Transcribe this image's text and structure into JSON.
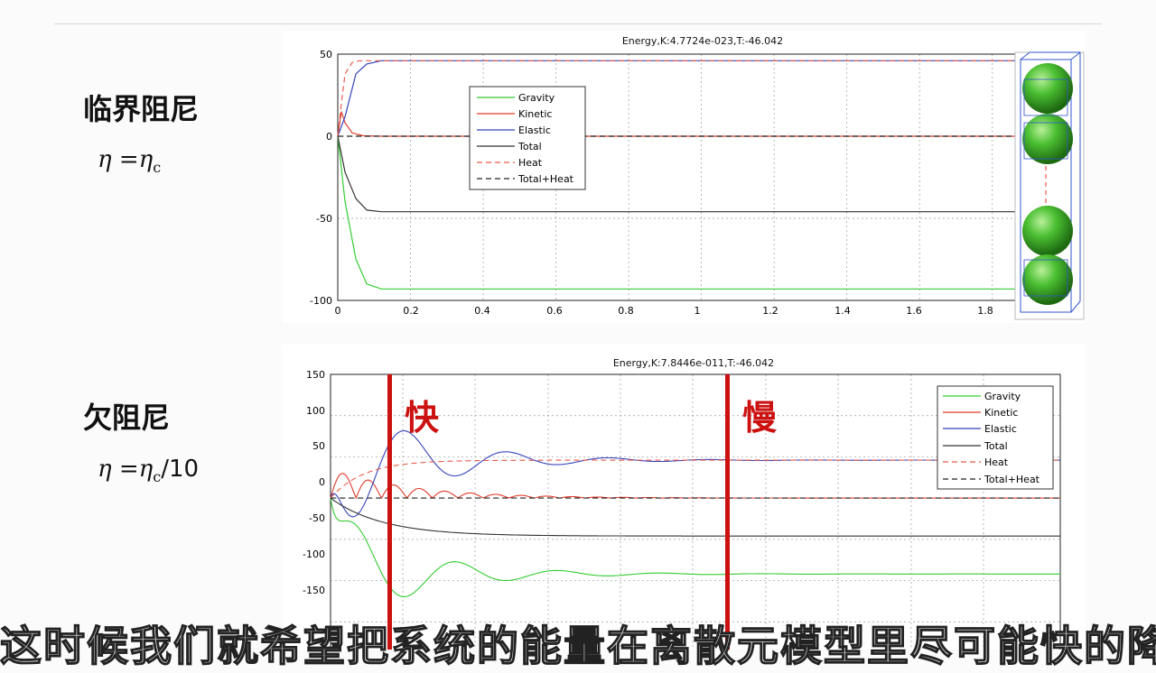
{
  "slide": {
    "critical_label": "临界阻尼",
    "critical_formula_lhs": "η =",
    "critical_formula_rhs": "η",
    "critical_formula_sub": "c",
    "under_label": "欠阻尼",
    "under_formula_lhs": "η =",
    "under_formula_rhs": "η",
    "under_formula_sub": "c",
    "under_formula_tail": "/10",
    "subtitle": "这时候我们就希望把系统的能量在离散元模型里尽可能快的降低"
  },
  "colors": {
    "gravity": "#33cc33",
    "kinetic": "#e03b2a",
    "elastic": "#3344bb",
    "total": "#333333",
    "heat": "#e85a4a",
    "total_heat": "#222222",
    "marker": "#cc1111",
    "sphere": "#3fae2a"
  },
  "chart_data": [
    {
      "type": "line",
      "title": "Energy,K:4.7724e-023,T:-46.042",
      "xlim": [
        0,
        1.9
      ],
      "ylim": [
        -100,
        50
      ],
      "xticks": [
        "0",
        "0.2",
        "0.4",
        "0.6",
        "0.8",
        "1",
        "1.2",
        "1.4",
        "1.6",
        "1.8"
      ],
      "yticks": [
        "50",
        "0",
        "-50",
        "-100"
      ],
      "grid": true,
      "legend_position": "upper-left",
      "legend": [
        "Gravity",
        "Kinetic",
        "Elastic",
        "Total",
        "Heat",
        "Total+Heat"
      ],
      "series": [
        {
          "name": "Gravity",
          "x": [
            0,
            0.02,
            0.05,
            0.08,
            0.12,
            0.2,
            1.9
          ],
          "y": [
            0,
            -40,
            -75,
            -90,
            -93,
            -93,
            -93
          ]
        },
        {
          "name": "Kinetic",
          "x": [
            0,
            0.01,
            0.02,
            0.04,
            0.07,
            0.12,
            1.9
          ],
          "y": [
            0,
            15,
            8,
            2,
            0.3,
            0,
            0
          ]
        },
        {
          "name": "Elastic",
          "x": [
            0,
            0.02,
            0.05,
            0.08,
            0.12,
            0.2,
            1.9
          ],
          "y": [
            0,
            12,
            38,
            44,
            46,
            46,
            46
          ]
        },
        {
          "name": "Total",
          "x": [
            0,
            0.02,
            0.05,
            0.08,
            0.12,
            1.9
          ],
          "y": [
            0,
            -22,
            -38,
            -45,
            -46,
            -46
          ]
        },
        {
          "name": "Heat",
          "x": [
            0,
            0.01,
            0.02,
            0.04,
            0.06,
            0.1,
            1.9
          ],
          "y": [
            0,
            20,
            38,
            45,
            46,
            46,
            46
          ]
        },
        {
          "name": "Total+Heat",
          "x": [
            0,
            1.9
          ],
          "y": [
            0,
            0
          ]
        }
      ]
    },
    {
      "type": "line",
      "title": "Energy,K:7.8446e-011,T:-46.042",
      "ylim": [
        -200,
        150
      ],
      "yticks": [
        "150",
        "100",
        "50",
        "0",
        "-50",
        "-100",
        "-150"
      ],
      "grid": true,
      "legend_position": "upper-right",
      "legend": [
        "Gravity",
        "Kinetic",
        "Elastic",
        "Total",
        "Heat",
        "Total+Heat"
      ],
      "annotations": [
        "快",
        "慢"
      ],
      "series": [
        {
          "name": "Gravity",
          "damped": true,
          "base": -92,
          "amp": 70
        },
        {
          "name": "Kinetic",
          "damped": true,
          "base": 0,
          "amp": 35
        },
        {
          "name": "Elastic",
          "damped": true,
          "base": 46,
          "amp": -90
        },
        {
          "name": "Total",
          "base": -46
        },
        {
          "name": "Heat",
          "base": 46
        },
        {
          "name": "Total+Heat",
          "base": 0
        }
      ]
    }
  ]
}
